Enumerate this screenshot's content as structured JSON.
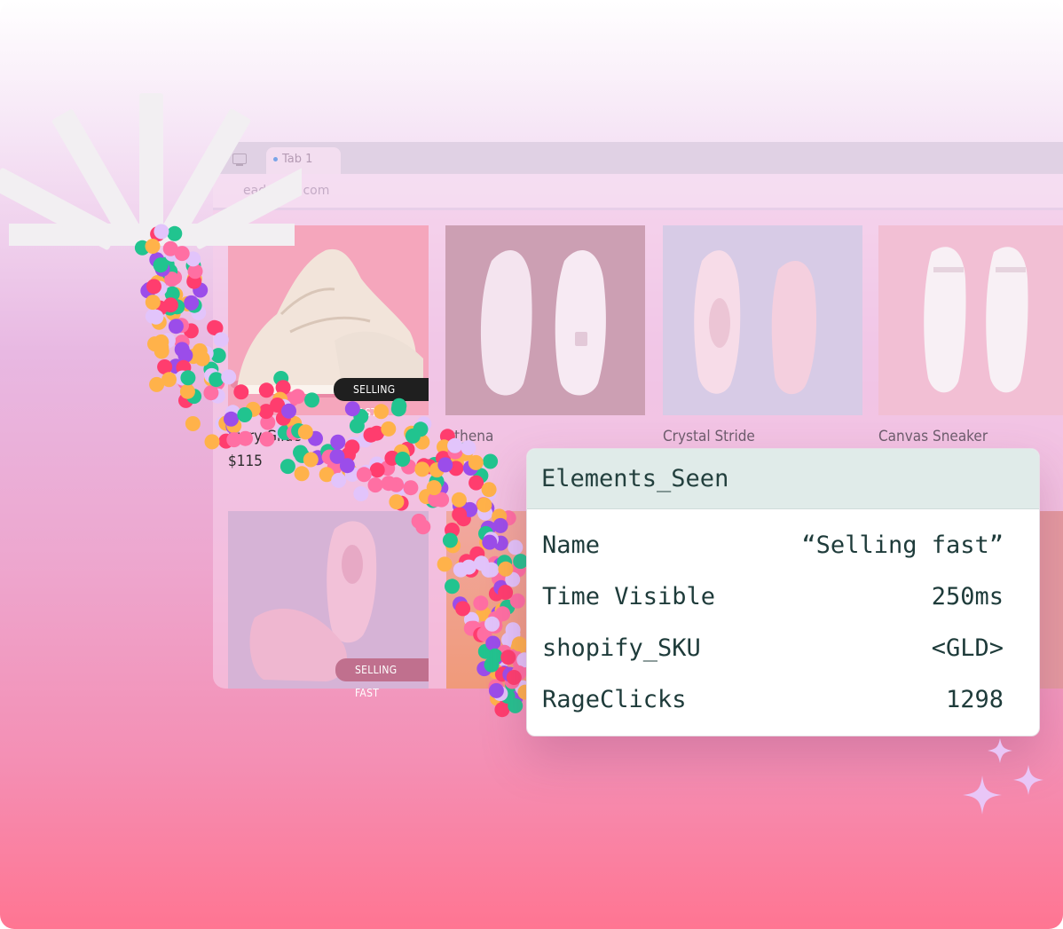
{
  "browser": {
    "tab_label": "Tab 1",
    "url": "eadwave.com"
  },
  "products": [
    {
      "name": "Ivory Glide",
      "price": "$115",
      "badge": "SELLING FAST"
    },
    {
      "name": "Athena",
      "price": ""
    },
    {
      "name": "Crystal Stride",
      "price": ""
    },
    {
      "name": "Canvas Sneaker",
      "price": ""
    },
    {
      "name": "",
      "badge": "SELLING FAST"
    }
  ],
  "panel": {
    "title": "Elements_Seen",
    "rows": [
      {
        "key": "Name",
        "value": "“Selling fast”"
      },
      {
        "key": "Time Visible",
        "value": "250ms"
      },
      {
        "key": "shopify_SKU",
        "value": "<GLD>"
      },
      {
        "key": "RageClicks",
        "value": "1298"
      }
    ]
  },
  "colors": {
    "dot_palette": [
      "#ff3d6e",
      "#21c48f",
      "#9b4dea",
      "#ffb24a",
      "#ff6fa3",
      "#e2c4fb"
    ],
    "panel_header": "#e0ebe9",
    "panel_text": "#1e3b3a"
  },
  "icons": [
    "monitor-icon",
    "burst-logo-icon",
    "sparkle-icon"
  ]
}
